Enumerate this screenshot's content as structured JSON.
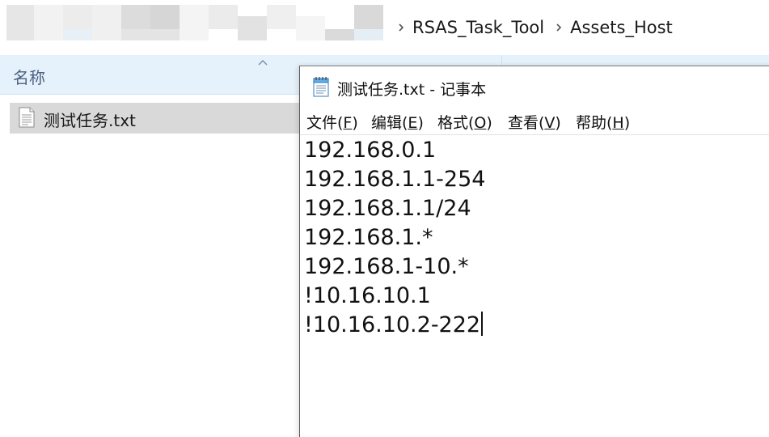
{
  "explorer": {
    "breadcrumb": [
      "RSAS_Task_Tool",
      "Assets_Host"
    ],
    "column_header": "名称",
    "files": [
      {
        "name": "测试任务.txt",
        "icon": "text-file-icon",
        "selected": true
      }
    ]
  },
  "notepad": {
    "title": "测试任务.txt - 记事本",
    "menu": [
      {
        "label": "文件(",
        "key": "F",
        "tail": ")"
      },
      {
        "label": "编辑(",
        "key": "E",
        "tail": ")"
      },
      {
        "label": "格式(",
        "key": "O",
        "tail": ")"
      },
      {
        "label": "查看(",
        "key": "V",
        "tail": ")"
      },
      {
        "label": "帮助(",
        "key": "H",
        "tail": ")"
      }
    ],
    "lines": [
      "192.168.0.1",
      "192.168.1.1-254",
      "192.168.1.1/24",
      "192.168.1.*",
      "192.168.1-10.*",
      "!10.16.10.1",
      "!10.16.10.2-222"
    ]
  },
  "colors": {
    "header_bg": "#e5f1fb",
    "selection_bg": "#d9d9d9",
    "header_text": "#4d6082"
  }
}
